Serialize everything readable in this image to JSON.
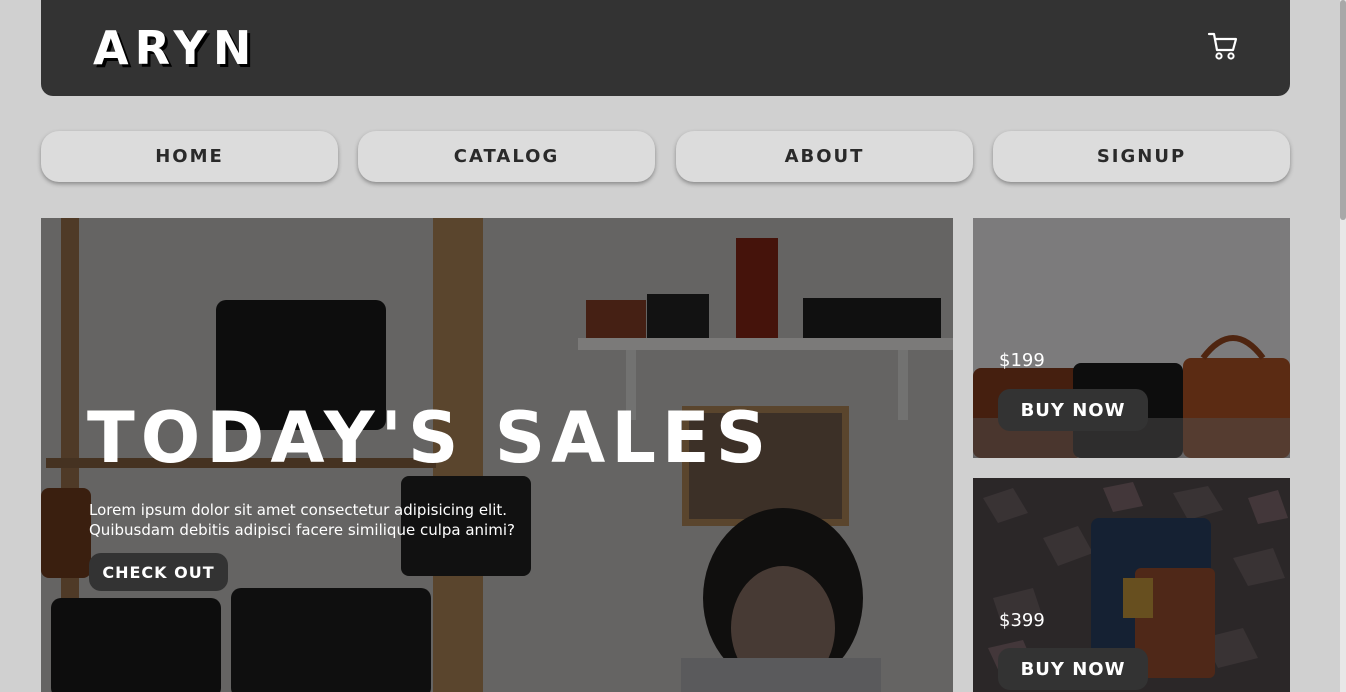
{
  "header": {
    "logo": "ARYN",
    "cart_icon": "cart-icon"
  },
  "nav": {
    "items": [
      {
        "label": "HOME"
      },
      {
        "label": "CATALOG"
      },
      {
        "label": "ABOUT"
      },
      {
        "label": "SIGNUP"
      }
    ]
  },
  "hero": {
    "title": "TODAY'S SALES",
    "description": "Lorem ipsum dolor sit amet consectetur adipisicing elit. Quibusdam debitis adipisci facere similique culpa animi?",
    "button": "CHECK OUT"
  },
  "products": [
    {
      "price": "$199",
      "button": "BUY NOW"
    },
    {
      "price": "$399",
      "button": "BUY NOW"
    }
  ],
  "colors": {
    "header_bg": "#333333",
    "page_bg": "#d0d0d0",
    "nav_bg": "#dcdcdc",
    "button_bg": "#333333",
    "text_light": "#ffffff"
  }
}
